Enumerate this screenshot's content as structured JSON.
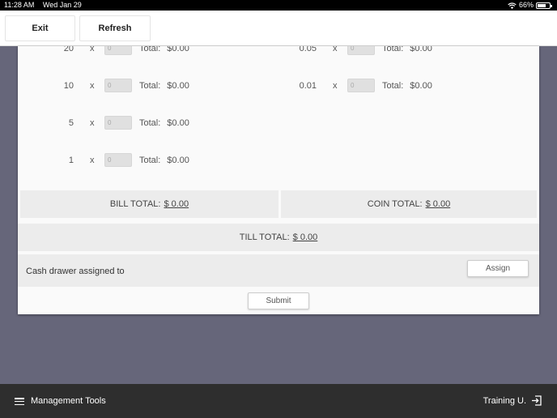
{
  "status_bar": {
    "time": "11:28 AM",
    "date": "Wed Jan 29",
    "battery": "66%"
  },
  "top_bar": {
    "exit_label": "Exit",
    "refresh_label": "Refresh"
  },
  "bills": [
    {
      "denomination": "20",
      "x": "x",
      "qty_placeholder": "0",
      "total_label": "Total:",
      "total": "$0.00"
    },
    {
      "denomination": "10",
      "x": "x",
      "qty_placeholder": "0",
      "total_label": "Total:",
      "total": "$0.00"
    },
    {
      "denomination": "5",
      "x": "x",
      "qty_placeholder": "0",
      "total_label": "Total:",
      "total": "$0.00"
    },
    {
      "denomination": "1",
      "x": "x",
      "qty_placeholder": "0",
      "total_label": "Total:",
      "total": "$0.00"
    }
  ],
  "coins": [
    {
      "denomination": "0.05",
      "x": "x",
      "qty_placeholder": "0",
      "total_label": "Total:",
      "total": "$0.00"
    },
    {
      "denomination": "0.01",
      "x": "x",
      "qty_placeholder": "0",
      "total_label": "Total:",
      "total": "$0.00"
    }
  ],
  "totals": {
    "bill_label": "BILL TOTAL:",
    "bill_amount": "$ 0.00",
    "coin_label": "COIN TOTAL:",
    "coin_amount": "$ 0.00",
    "till_label": "TILL TOTAL:",
    "till_amount": "$ 0.00"
  },
  "assign": {
    "label": "Cash drawer assigned to",
    "button": "Assign"
  },
  "submit_label": "Submit",
  "bottom_bar": {
    "menu_label": "Management Tools",
    "user_label": "Training U."
  },
  "colors": {
    "background": "#66667a",
    "card": "#fafafa",
    "total_box": "#ececec",
    "bottom_bar": "#2e2e2e"
  }
}
